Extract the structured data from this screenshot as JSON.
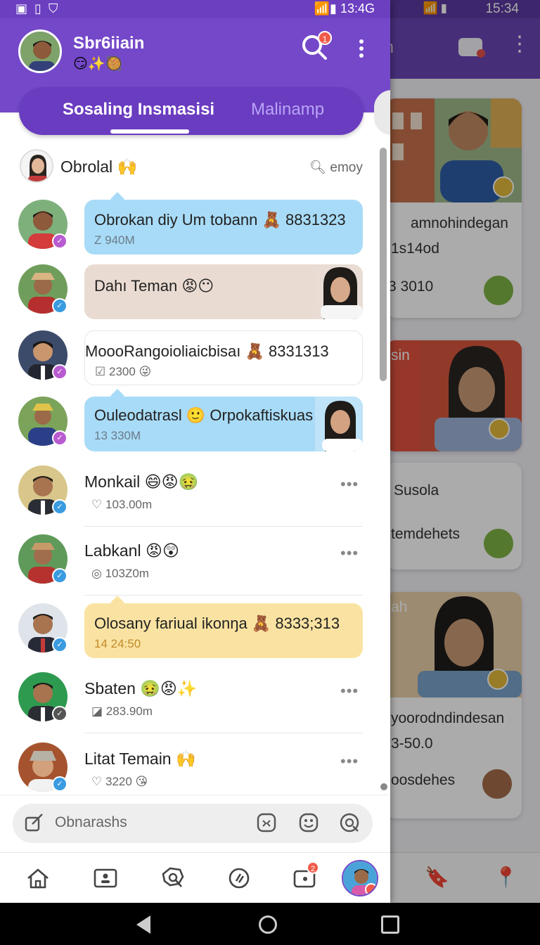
{
  "status_left": {
    "time": "13:4G"
  },
  "status_right": {
    "time": "15:34"
  },
  "profile": {
    "name": "Sbr6iiain",
    "status_emoji": "😏✨🥘"
  },
  "header": {
    "search_badge": "1"
  },
  "tabs": [
    {
      "label": "Sosaling Insmasisi",
      "active": true
    },
    {
      "label": "Malinamp",
      "active": false
    }
  ],
  "list_header": {
    "title": "Obrolal",
    "title_emoji": "🙌",
    "search_label": "emоy"
  },
  "chats": [
    {
      "title": "Obrokan diy Um tobann",
      "emoji": "🧸",
      "number": "8831323",
      "meta_icon": "Z",
      "meta": "940M",
      "style": "bubble-blue",
      "badge_color": "#b85bd0"
    },
    {
      "title": "Dahı Teman",
      "emoji": "😡😶",
      "meta": "",
      "style": "bubble-beige",
      "badge_color": "#3a9be0"
    },
    {
      "title": "MoooRangoioliaicbisaı",
      "emoji": "🧸",
      "number": "8331313",
      "meta_icon": "☑",
      "meta": "2300",
      "meta_emoji": "😜",
      "style": "bubble-white",
      "badge_color": "#b85bd0"
    },
    {
      "title": "Ouleodatrasl",
      "emoji": "🙂",
      "title2": "Orpokaftiskuas",
      "meta": "13 330M",
      "style": "bubble-blue-photo",
      "badge_color": "#b85bd0"
    },
    {
      "title": "Monkail",
      "emoji": "😄😡🤢",
      "meta_icon": "♡",
      "meta": "103.00m",
      "style": "plain",
      "badge_color": "#3a9be0"
    },
    {
      "title": "Labkanl",
      "emoji": "😡😲",
      "meta_icon": "◎",
      "meta": "103Z0m",
      "style": "plain",
      "badge_color": "#3a9be0"
    },
    {
      "title": "Olosany fariual ikonŋa",
      "emoji": "🧸",
      "number": "8333;313",
      "meta": "14 24:50",
      "style": "bubble-yellow",
      "badge_color": "#3a9be0"
    },
    {
      "title": "Sbaten",
      "emoji": "🤢😡✨",
      "meta_icon": "◪",
      "meta": "283.90m",
      "style": "plain",
      "badge_color": "#555"
    },
    {
      "title": "Litat Temain",
      "emoji": "🙌",
      "meta_icon": "♡",
      "meta": "3220",
      "meta_emoji": "😘",
      "style": "plain",
      "badge_color": "#3a9be0"
    }
  ],
  "compose": {
    "placeholder": "Obnarashs"
  },
  "nav_badge": "2",
  "background_app": {
    "header_title": "m",
    "cards": [
      {
        "line1": "amnohindegan",
        "line2": "1s14od",
        "line3": "3 3010"
      },
      {
        "line1": "sin",
        "line2": "",
        "line3": ""
      },
      {
        "line1": "Susola",
        "line2": "temdehets",
        "line3": ""
      },
      {
        "line1": "ah",
        "line2": "yoorodndindesan",
        "line3": "3-50.0",
        "line4": "oosdehes"
      }
    ]
  },
  "colors": {
    "accent": "#7448c9",
    "accent_dark": "#6a3cc0",
    "bubble_blue": "#a8dbf7",
    "bubble_beige": "#eadbd2",
    "bubble_yellow": "#fae3a2",
    "badge_red": "#f05a4a"
  }
}
